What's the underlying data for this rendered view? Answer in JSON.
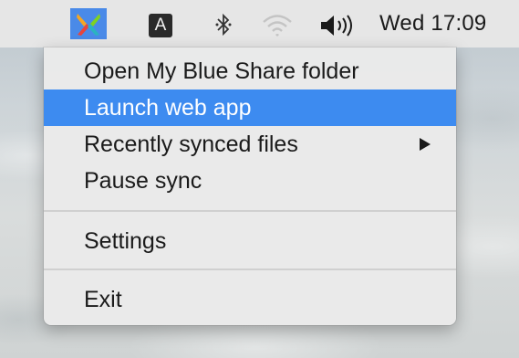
{
  "menubar": {
    "app_icon": "blue-share-app-icon",
    "input_source_label": "A",
    "bluetooth_icon": "bluetooth-icon",
    "wifi_icon": "wifi-icon",
    "volume_icon": "volume-icon",
    "clock": "Wed 17:09",
    "app_icon_bg": "#4a8ae8"
  },
  "menu": {
    "items": [
      {
        "label": "Open My Blue Share folder"
      },
      {
        "label": "Launch web app"
      },
      {
        "label": "Recently synced files"
      },
      {
        "label": "Pause sync"
      },
      {
        "label": "Settings"
      },
      {
        "label": "Exit"
      }
    ],
    "selected_index": 1,
    "highlight_color": "#3d8bf0"
  }
}
